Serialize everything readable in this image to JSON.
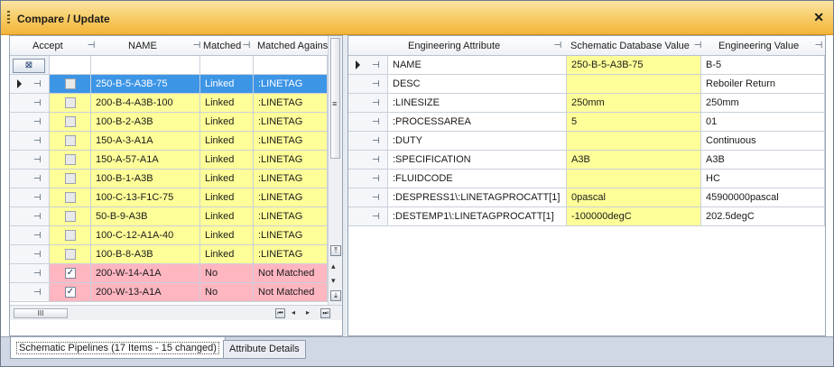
{
  "window": {
    "title": "Compare / Update"
  },
  "left_grid": {
    "columns": [
      "Accept",
      "NAME",
      "Matched",
      "Matched Against"
    ],
    "filter_icon": "filter-clear-icon",
    "rows": [
      {
        "accept": false,
        "name": "250-B-5-A3B-75",
        "matched": "Linked",
        "against": ":LINETAG",
        "state": "selected"
      },
      {
        "accept": false,
        "name": "200-B-4-A3B-100",
        "matched": "Linked",
        "against": ":LINETAG",
        "state": "yellow"
      },
      {
        "accept": false,
        "name": "100-B-2-A3B",
        "matched": "Linked",
        "against": ":LINETAG",
        "state": "yellow"
      },
      {
        "accept": false,
        "name": "150-A-3-A1A",
        "matched": "Linked",
        "against": ":LINETAG",
        "state": "yellow"
      },
      {
        "accept": false,
        "name": "150-A-57-A1A",
        "matched": "Linked",
        "against": ":LINETAG",
        "state": "yellow"
      },
      {
        "accept": false,
        "name": "100-B-1-A3B",
        "matched": "Linked",
        "against": ":LINETAG",
        "state": "yellow"
      },
      {
        "accept": false,
        "name": "100-C-13-F1C-75",
        "matched": "Linked",
        "against": ":LINETAG",
        "state": "yellow"
      },
      {
        "accept": false,
        "name": "50-B-9-A3B",
        "matched": "Linked",
        "against": ":LINETAG",
        "state": "yellow"
      },
      {
        "accept": false,
        "name": "100-C-12-A1A-40",
        "matched": "Linked",
        "against": ":LINETAG",
        "state": "yellow"
      },
      {
        "accept": false,
        "name": "100-B-8-A3B",
        "matched": "Linked",
        "against": ":LINETAG",
        "state": "yellow"
      },
      {
        "accept": true,
        "name": "200-W-14-A1A",
        "matched": "No",
        "against": "Not Matched",
        "state": "pink"
      },
      {
        "accept": true,
        "name": "200-W-13-A1A",
        "matched": "No",
        "against": "Not Matched",
        "state": "pink"
      }
    ]
  },
  "right_grid": {
    "columns": [
      "Engineering Attribute",
      "Schematic Database Value",
      "Engineering Value"
    ],
    "rows": [
      {
        "attr": "NAME",
        "schem": "250-B-5-A3B-75",
        "eng": "B-5",
        "current": true
      },
      {
        "attr": "DESC",
        "schem": "",
        "eng": "Reboiler Return",
        "current": false
      },
      {
        "attr": ":LINESIZE",
        "schem": "250mm",
        "eng": "250mm",
        "current": false
      },
      {
        "attr": ":PROCESSAREA",
        "schem": "5",
        "eng": "01",
        "current": false
      },
      {
        "attr": ":DUTY",
        "schem": "",
        "eng": "Continuous",
        "current": false
      },
      {
        "attr": ":SPECIFICATION",
        "schem": "A3B",
        "eng": "A3B",
        "current": false
      },
      {
        "attr": ":FLUIDCODE",
        "schem": "",
        "eng": "HC",
        "current": false
      },
      {
        "attr": ":DESPRESS1\\:LINETAGPROCATT[1]",
        "schem": "0pascal",
        "eng": "45900000pascal",
        "current": false
      },
      {
        "attr": ":DESTEMP1\\:LINETAGPROCATT[1]",
        "schem": "-100000degC",
        "eng": "202.5degC",
        "current": false
      }
    ]
  },
  "scroll": {
    "h_thumb_glyph": "III"
  },
  "tabs": [
    {
      "label": "Schematic Pipelines (17 Items - 15 changed)",
      "active": true
    },
    {
      "label": "Attribute Details",
      "active": false
    }
  ],
  "colors": {
    "linked_row": "#ffff99",
    "unmatched_row": "#ffb6c1",
    "selected_row": "#3d95e6",
    "title_bar": "#f8cf6c"
  }
}
